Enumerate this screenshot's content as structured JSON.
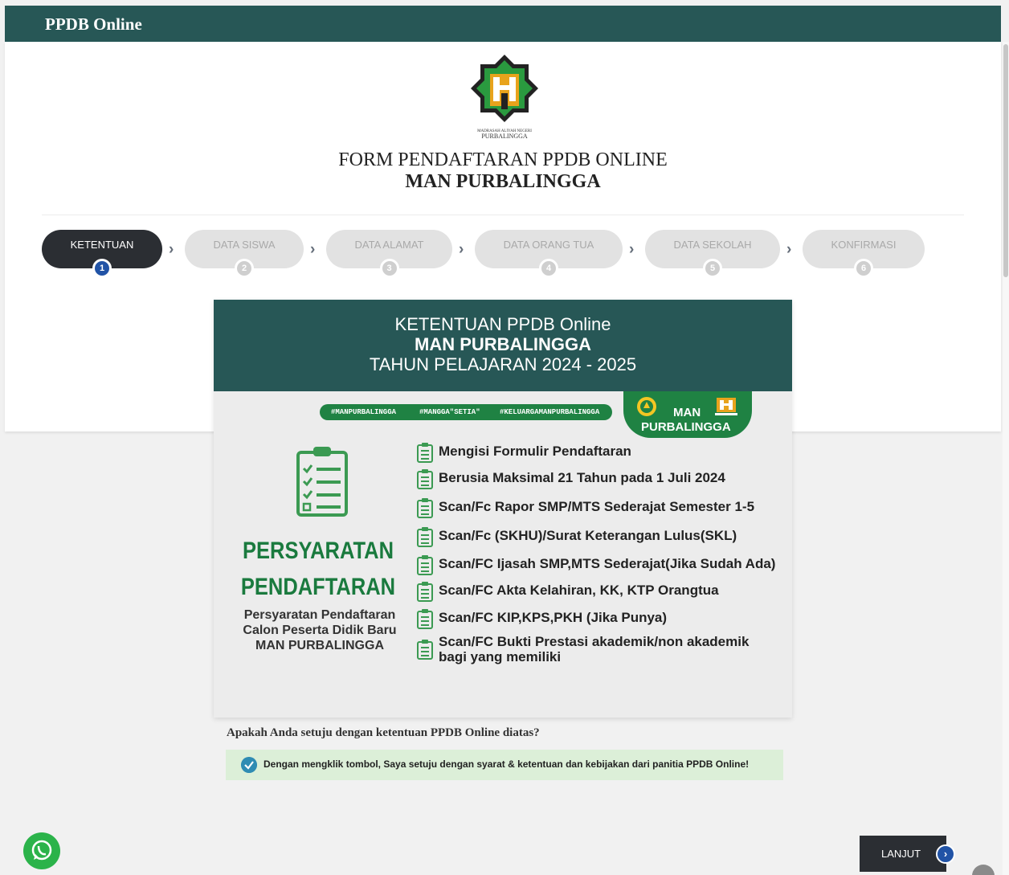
{
  "header": {
    "brand": "PPDB Online"
  },
  "page": {
    "logo_caption": "PURBALINGGA",
    "title_line1": "FORM PENDAFTARAN PPDB ONLINE",
    "title_line2": "MAN PURBALINGGA"
  },
  "steps": [
    {
      "label": "KETENTUAN",
      "num": "1",
      "active": true
    },
    {
      "label": "DATA SISWA",
      "num": "2"
    },
    {
      "label": "DATA ALAMAT",
      "num": "3"
    },
    {
      "label": "DATA ORANG TUA",
      "num": "4"
    },
    {
      "label": "DATA SEKOLAH",
      "num": "5"
    },
    {
      "label": "KONFIRMASI",
      "num": "6"
    }
  ],
  "banner": {
    "head1": "KETENTUAN PPDB Online",
    "head2": "MAN PURBALINGGA",
    "head3": "TAHUN PELAJARAN 2024 - 2025",
    "hashtags": [
      "#MANPURBALINGGA",
      "#MANGGA\"SETIA\"",
      "#KELUARGAMANPURBALINGGA"
    ],
    "tag_line1": "MAN",
    "tag_line2": "PURBALINGGA",
    "persyaratan": "PERSYARATAN",
    "pendaftaran": "PENDAFTARAN",
    "sub1": "Persyaratan Pendaftaran",
    "sub2": "Calon Peserta Didik Baru",
    "sub3": "MAN PURBALINGGA",
    "requirements": [
      "Mengisi Formulir Pendaftaran",
      "Berusia Maksimal 21 Tahun pada 1 Juli 2024",
      "Scan/Fc Rapor SMP/MTS Sederajat Semester 1-5",
      "Scan/Fc (SKHU)/Surat Keterangan Lulus(SKL)",
      "Scan/FC Ijasah SMP,MTS Sederajat(Jika Sudah Ada)",
      "Scan/FC Akta Kelahiran, KK, KTP Orangtua",
      "Scan/FC KIP,KPS,PKH (Jika Punya)",
      "Scan/FC Bukti Prestasi akademik/non akademik",
      "bagi yang memiliki"
    ]
  },
  "agreement": {
    "question": "Apakah Anda setuju dengan ketentuan PPDB Online diatas?",
    "text": "Dengan mengklik tombol, Saya setuju dengan syarat & ketentuan dan kebijakan dari panitia PPDB Online!"
  },
  "actions": {
    "next": "LANJUT"
  },
  "colors": {
    "primary": "#275756",
    "accent_green": "#1f8243",
    "step_active": "#2b2e33",
    "step_number": "#2153a6"
  },
  "icons": {
    "whatsapp": "whatsapp-icon",
    "next": "chevron-right-icon",
    "check": "check-circle-icon"
  }
}
